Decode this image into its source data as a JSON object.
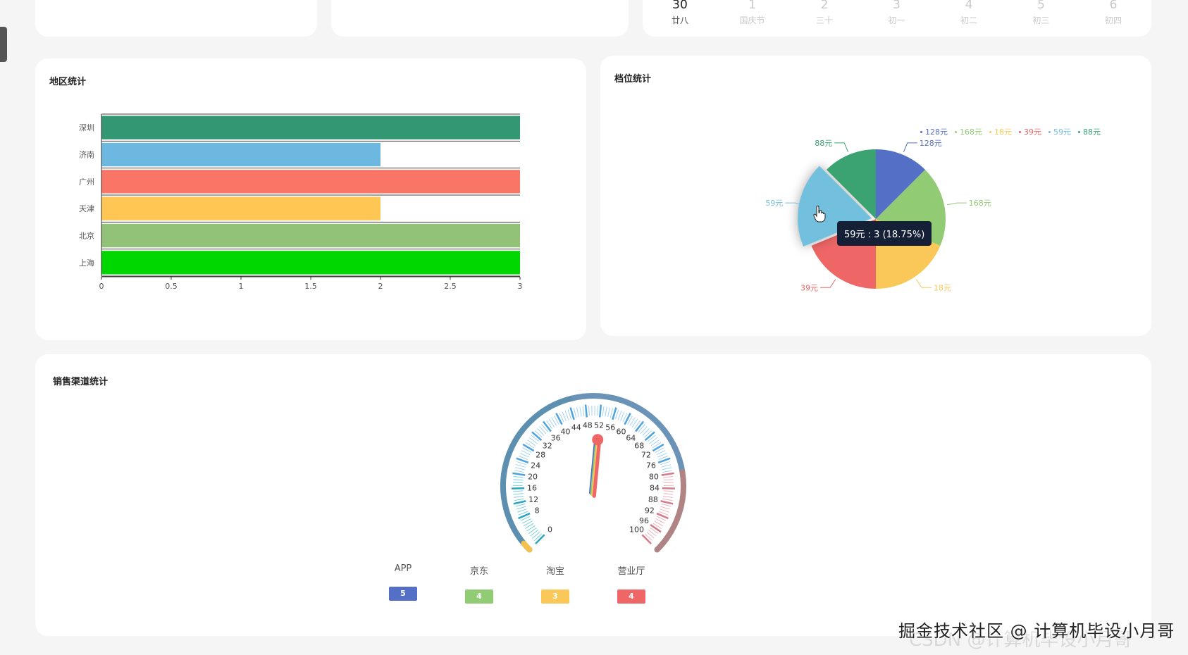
{
  "calendar": {
    "days": [
      {
        "num": "30",
        "sub": "廿八",
        "active": true
      },
      {
        "num": "1",
        "sub": "国庆节",
        "active": false
      },
      {
        "num": "2",
        "sub": "三十",
        "active": false
      },
      {
        "num": "3",
        "sub": "初一",
        "active": false
      },
      {
        "num": "4",
        "sub": "初二",
        "active": false
      },
      {
        "num": "5",
        "sub": "初三",
        "active": false
      },
      {
        "num": "6",
        "sub": "初四",
        "active": false
      }
    ]
  },
  "region": {
    "title": "地区统计"
  },
  "tier": {
    "title": "档位统计"
  },
  "channel": {
    "title": "销售渠道统计"
  },
  "tooltip": {
    "text": "59元 : 3 (18.75%)"
  },
  "watermark": {
    "text": "掘金技术社区 @ 计算机毕设小月哥",
    "faint": "CSDN @计算机毕设小月哥"
  },
  "chart_data": [
    {
      "type": "bar",
      "orientation": "horizontal",
      "title": "地区统计",
      "categories": [
        "深圳",
        "济南",
        "广州",
        "天津",
        "北京",
        "上海"
      ],
      "values": [
        3,
        2,
        3,
        2,
        3,
        3
      ],
      "colors": [
        "#329772",
        "#6cb8e0",
        "#f97565",
        "#ffc653",
        "#92c278",
        "#00d600"
      ],
      "xlim": [
        0,
        3
      ],
      "xticks": [
        "0",
        "0.5",
        "1",
        "1.5",
        "2",
        "2.5",
        "3"
      ]
    },
    {
      "type": "pie",
      "title": "档位统计",
      "labels": [
        "128元",
        "168元",
        "18元",
        "39元",
        "59元",
        "88元"
      ],
      "values": [
        2,
        3,
        3,
        3,
        3,
        2
      ],
      "colors": [
        "#5470c6",
        "#91cc75",
        "#fac858",
        "#ee6666",
        "#73c0de",
        "#3ba272"
      ],
      "highlighted": "59元",
      "legend": "top-right"
    },
    {
      "type": "gauge",
      "title": "销售渠道统计",
      "min": 0,
      "max": 100,
      "ticks": [
        "0",
        "8",
        "12",
        "16",
        "20",
        "24",
        "28",
        "32",
        "36",
        "40",
        "44",
        "48",
        "52",
        "56",
        "60",
        "64",
        "68",
        "72",
        "76",
        "80",
        "84",
        "88",
        "92",
        "96",
        "100"
      ],
      "series": [
        {
          "name": "APP",
          "value": 5,
          "color": "#5470c6"
        },
        {
          "name": "京东",
          "value": 4,
          "color": "#91cc75"
        },
        {
          "name": "淘宝",
          "value": 3,
          "color": "#fac858"
        },
        {
          "name": "营业厅",
          "value": 4,
          "color": "#ee6666"
        }
      ]
    }
  ]
}
